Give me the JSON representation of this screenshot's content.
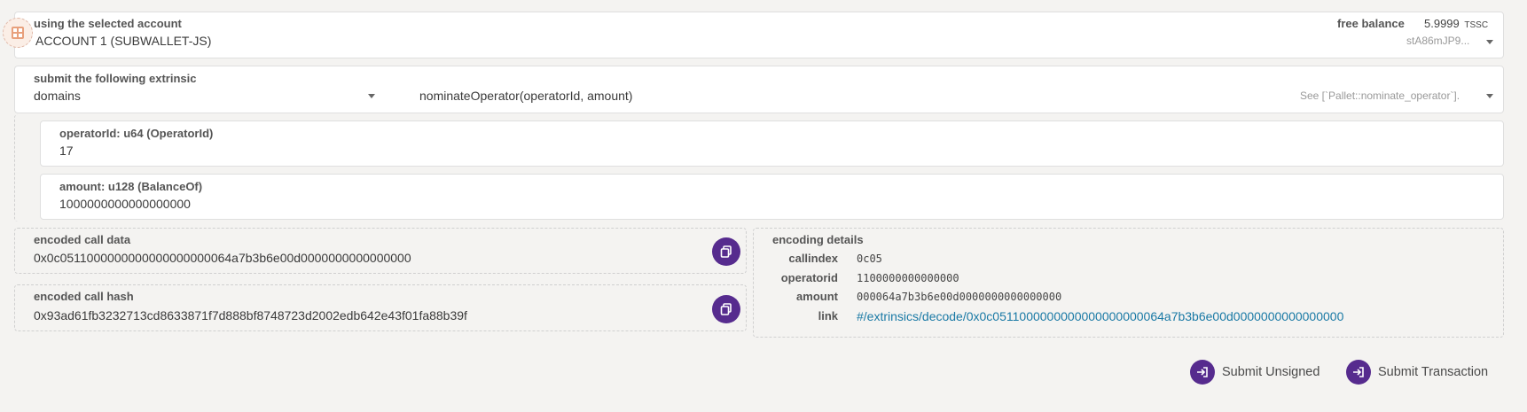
{
  "account": {
    "label": "using the selected account",
    "name": "ACCOUNT 1 (SUBWALLET-JS)",
    "balance_label": "free balance",
    "balance_value": "5.9999",
    "balance_unit": "TSSC",
    "address": "stA86mJP9..."
  },
  "extrinsic": {
    "label": "submit the following extrinsic",
    "section": "domains",
    "method": "nominateOperator(operatorId, amount)",
    "doc": "See [`Pallet::nominate_operator`]."
  },
  "params": [
    {
      "label": "operatorId: u64 (OperatorId)",
      "value": "17"
    },
    {
      "label": "amount: u128 (BalanceOf)",
      "value": "1000000000000000000"
    }
  ],
  "encoded": {
    "call_data_label": "encoded call data",
    "call_data": "0x0c0511000000000000000000064a7b3b6e00d0000000000000000",
    "call_hash_label": "encoded call hash",
    "call_hash": "0x93ad61fb3232713cd8633871f7d888bf8748723d2002edb642e43f01fa88b39f"
  },
  "details": {
    "label": "encoding details",
    "rows": [
      {
        "key": "callindex",
        "value": "0c05"
      },
      {
        "key": "operatorid",
        "value": "1100000000000000"
      },
      {
        "key": "amount",
        "value": "000064a7b3b6e00d0000000000000000"
      },
      {
        "key": "link",
        "value": "#/extrinsics/decode/0x0c0511000000000000000000064a7b3b6e00d0000000000000000"
      }
    ]
  },
  "actions": {
    "submit_unsigned": "Submit Unsigned",
    "submit_transaction": "Submit Transaction"
  },
  "colors": {
    "accent": "#562b8e",
    "link": "#1979a5",
    "background": "#f4f3f1"
  }
}
